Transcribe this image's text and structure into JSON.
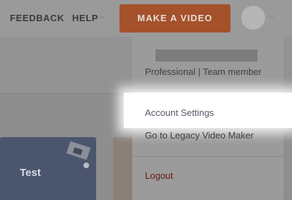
{
  "nav": {
    "feedback": "FEEDBACK",
    "help": "HELP",
    "make_video": "MAKE A VIDEO"
  },
  "menu": {
    "plan": "Professional | Team member",
    "account_settings": "Account Settings",
    "legacy": "Go to Legacy Video Maker",
    "logout": "Logout"
  },
  "cards": [
    {
      "title": "Test"
    }
  ],
  "colors": {
    "accent": "#a4512c",
    "logout": "#6a1818"
  },
  "icons": [
    "chevron-down-icon",
    "avatar",
    "desk-illustration"
  ]
}
